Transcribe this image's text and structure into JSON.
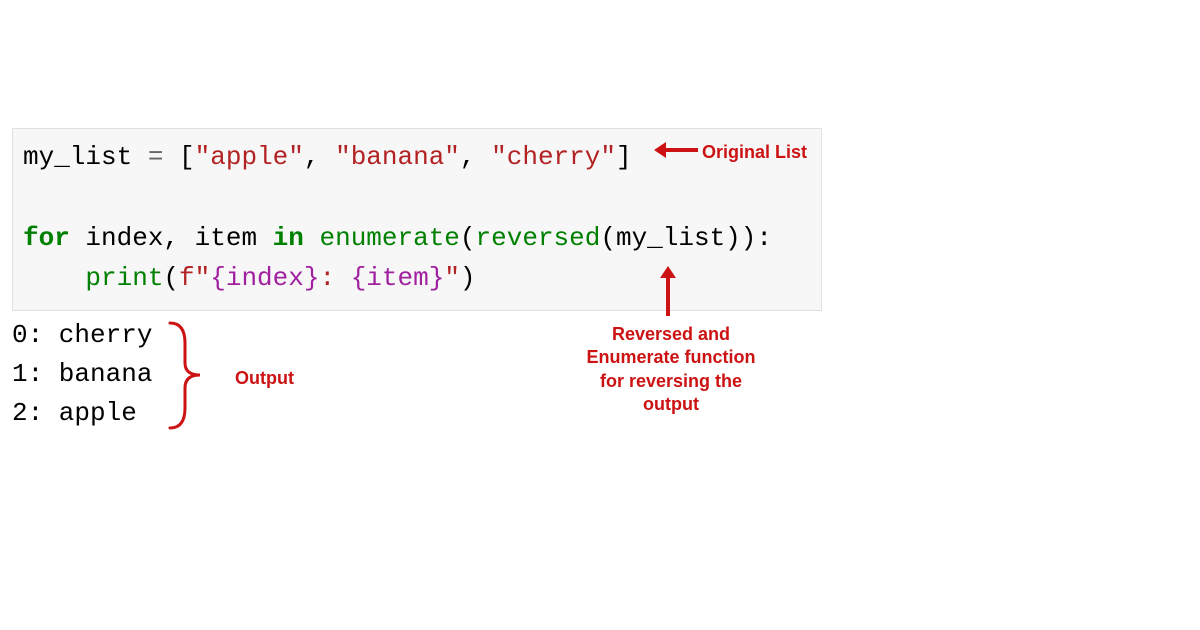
{
  "code": {
    "line1": {
      "var": "my_list ",
      "eq": "= ",
      "br_open": "[",
      "s1": "\"apple\"",
      "c1": ", ",
      "s2": "\"banana\"",
      "c2": ", ",
      "s3": "\"cherry\"",
      "br_close": "]"
    },
    "line3": {
      "for_kw": "for",
      "vars": " index, item ",
      "in_kw": "in",
      "sp": " ",
      "enum_fn": "enumerate",
      "po": "(",
      "rev_fn": "reversed",
      "arg": "(my_list)):"
    },
    "line4": {
      "print_fn": "print",
      "po": "(",
      "fpref": "f\"",
      "i1": "{index}",
      "colon": ": ",
      "i2": "{item}",
      "fend": "\"",
      "pc": ")"
    }
  },
  "output": {
    "l0": "0: cherry",
    "l1": "1: banana",
    "l2": "2: apple"
  },
  "annotations": {
    "original": "Original List",
    "output": "Output",
    "reversed": "Reversed and Enumerate function for reversing the output"
  }
}
